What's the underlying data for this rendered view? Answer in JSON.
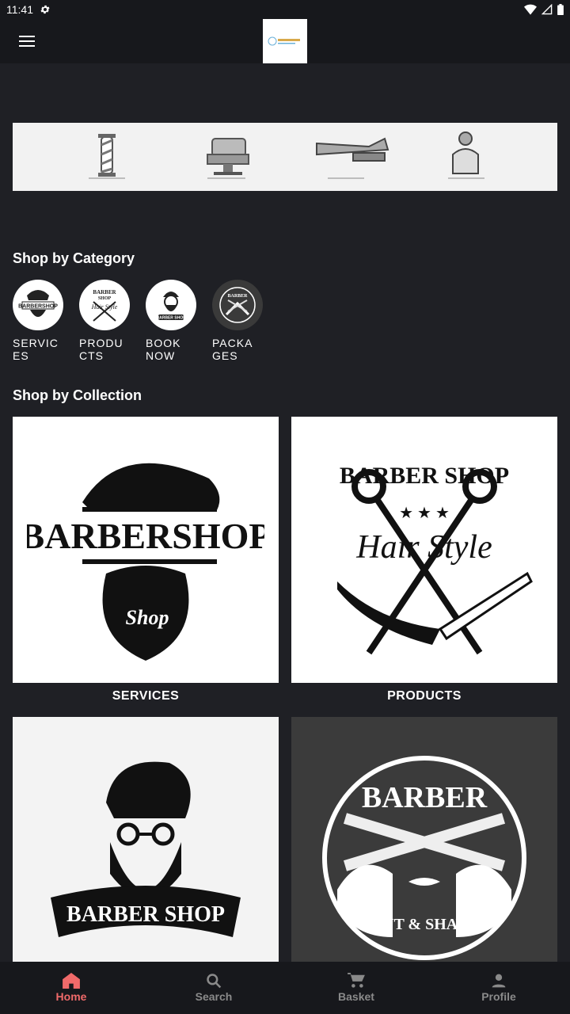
{
  "status_bar": {
    "time": "11:41"
  },
  "sections": {
    "category_title": "Shop by Category",
    "collection_title": "Shop by Collection"
  },
  "categories": [
    {
      "label": "SERVICES"
    },
    {
      "label": "PRODUCTS"
    },
    {
      "label": "BOOK NOW"
    },
    {
      "label": "PACKAGES"
    }
  ],
  "collections": [
    {
      "label": "SERVICES",
      "image_text": "BARBERSHOP",
      "image_subtext": "Shop"
    },
    {
      "label": "PRODUCTS",
      "image_text": "BARBER SHOP",
      "image_subtext": "Hair Style"
    },
    {
      "label": "",
      "image_text": "BARBER SHOP",
      "image_subtext": ""
    },
    {
      "label": "",
      "image_text": "BARBER",
      "image_subtext": "CUT & SHAVE"
    }
  ],
  "bottom_nav": [
    {
      "label": "Home",
      "active": true
    },
    {
      "label": "Search",
      "active": false
    },
    {
      "label": "Basket",
      "active": false
    },
    {
      "label": "Profile",
      "active": false
    }
  ],
  "colors": {
    "background": "#1f2025",
    "bar": "#17181c",
    "accent": "#f06a6a",
    "inactive": "#8a8a8a"
  }
}
